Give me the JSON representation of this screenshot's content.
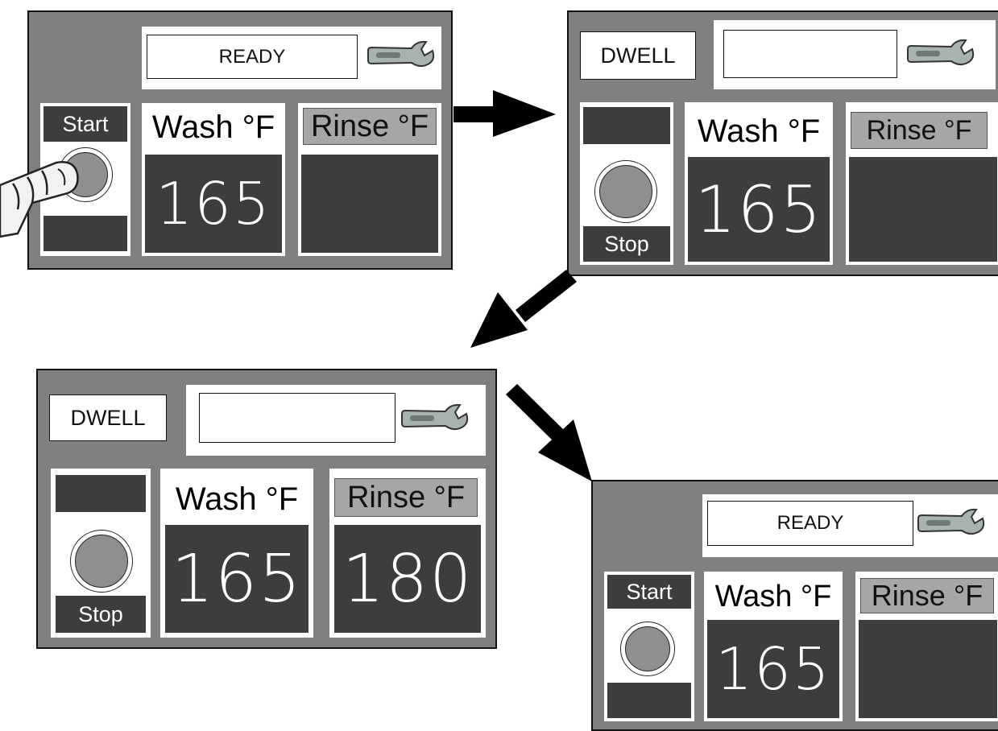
{
  "panel_1": {
    "status_text": "READY",
    "button_label": "Start",
    "wash_header": "Wash °F",
    "wash_value": "165",
    "rinse_header": "Rinse °F",
    "rinse_value": ""
  },
  "panel_2": {
    "mode_text": "DWELL",
    "status_text": "",
    "button_label": "Stop",
    "wash_header": "Wash °F",
    "wash_value": "165",
    "rinse_header": "Rinse °F",
    "rinse_value": ""
  },
  "panel_3": {
    "mode_text": "DWELL",
    "status_text": "",
    "button_label": "Stop",
    "wash_header": "Wash °F",
    "wash_value": "165",
    "rinse_header": "Rinse °F",
    "rinse_value": "180"
  },
  "panel_4": {
    "status_text": "READY",
    "button_label": "Start",
    "wash_header": "Wash °F",
    "wash_value": "165",
    "rinse_header": "Rinse °F",
    "rinse_value": ""
  },
  "colors": {
    "panel_bg": "#808080",
    "display_bg": "#3d3d3d",
    "rinse_header_bg": "#a6a6a6",
    "button_face": "#8f8f8f"
  },
  "icons": [
    "wrench-icon",
    "finger-pointer-icon",
    "arrow-icon"
  ]
}
